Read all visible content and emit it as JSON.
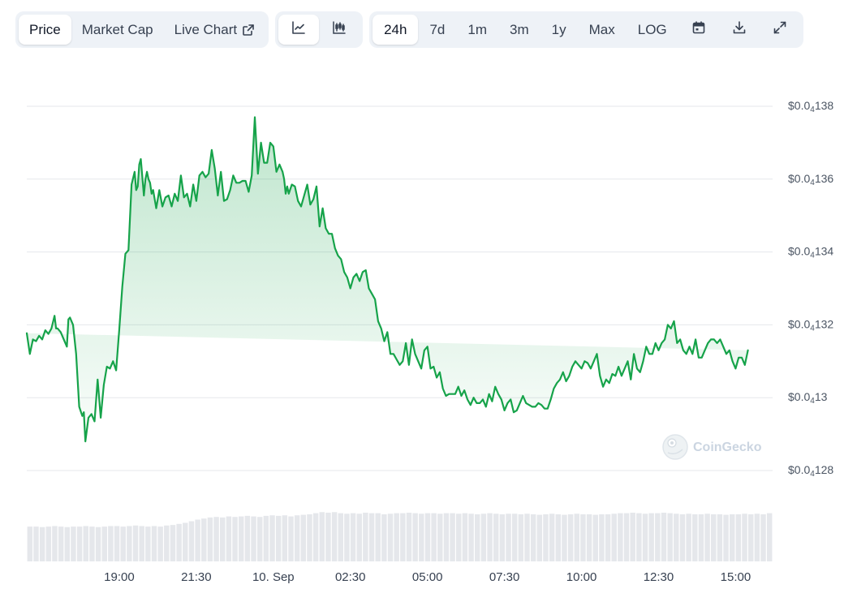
{
  "toolbar": {
    "view_tabs": [
      {
        "label": "Price",
        "active": true
      },
      {
        "label": "Market Cap",
        "active": false
      },
      {
        "label": "Live Chart",
        "active": false,
        "icon": "external-link-icon"
      }
    ],
    "chart_type_buttons": [
      {
        "icon": "line-chart-icon",
        "active": true
      },
      {
        "icon": "candlestick-chart-icon",
        "active": false
      }
    ],
    "time_ranges": [
      {
        "label": "24h",
        "active": true
      },
      {
        "label": "7d",
        "active": false
      },
      {
        "label": "1m",
        "active": false
      },
      {
        "label": "3m",
        "active": false
      },
      {
        "label": "1y",
        "active": false
      },
      {
        "label": "Max",
        "active": false
      },
      {
        "label": "LOG",
        "active": false
      }
    ],
    "tool_icons": [
      "calendar-icon",
      "download-icon",
      "expand-icon"
    ]
  },
  "watermark": {
    "text": "CoinGecko",
    "icon": "coingecko-logo-icon"
  },
  "colors": {
    "line": "#16a34a",
    "area_top": "#16a34a",
    "grid": "#e5e7eb",
    "volume": "#e5e7eb",
    "toolbar_bg": "#eef2f7"
  },
  "chart_data": {
    "type": "area",
    "title": "",
    "xlabel": "",
    "ylabel": "",
    "ylim": [
      1.28e-05,
      1.38e-05
    ],
    "y_ticks": [
      {
        "value": 1.38e-05,
        "prefix": "$0.0",
        "sub": "4",
        "digits": "138"
      },
      {
        "value": 1.36e-05,
        "prefix": "$0.0",
        "sub": "4",
        "digits": "136"
      },
      {
        "value": 1.34e-05,
        "prefix": "$0.0",
        "sub": "4",
        "digits": "134"
      },
      {
        "value": 1.32e-05,
        "prefix": "$0.0",
        "sub": "4",
        "digits": "132"
      },
      {
        "value": 1.3e-05,
        "prefix": "$0.0",
        "sub": "4",
        "digits": "13"
      },
      {
        "value": 1.28e-05,
        "prefix": "$0.0",
        "sub": "4",
        "digits": "128"
      }
    ],
    "x_ticks": [
      {
        "label": "19:00",
        "hours": 3.0
      },
      {
        "label": "21:30",
        "hours": 5.5
      },
      {
        "label": "10. Sep",
        "hours": 8.0
      },
      {
        "label": "02:30",
        "hours": 10.5
      },
      {
        "label": "05:00",
        "hours": 13.0
      },
      {
        "label": "07:30",
        "hours": 15.5
      },
      {
        "label": "10:00",
        "hours": 18.0
      },
      {
        "label": "12:30",
        "hours": 20.5
      },
      {
        "label": "15:00",
        "hours": 23.0
      }
    ],
    "x_range_hours": [
      0,
      24.2
    ],
    "grid": true,
    "price_series": {
      "hours": [
        0.0,
        0.1,
        0.2,
        0.3,
        0.4,
        0.5,
        0.6,
        0.7,
        0.8,
        0.9,
        0.95,
        1.0,
        1.1,
        1.2,
        1.3,
        1.35,
        1.4,
        1.5,
        1.6,
        1.7,
        1.8,
        1.85,
        1.9,
        2.0,
        2.1,
        2.2,
        2.3,
        2.4,
        2.5,
        2.6,
        2.7,
        2.8,
        2.9,
        3.0,
        3.1,
        3.2,
        3.3,
        3.4,
        3.5,
        3.55,
        3.6,
        3.65,
        3.7,
        3.8,
        3.85,
        3.9,
        3.95,
        4.0,
        4.05,
        4.1,
        4.15,
        4.2,
        4.3,
        4.4,
        4.5,
        4.6,
        4.7,
        4.8,
        4.9,
        5.0,
        5.1,
        5.2,
        5.3,
        5.4,
        5.5,
        5.6,
        5.7,
        5.8,
        5.9,
        6.0,
        6.1,
        6.2,
        6.3,
        6.4,
        6.5,
        6.6,
        6.7,
        6.8,
        6.9,
        7.0,
        7.1,
        7.2,
        7.3,
        7.4,
        7.5,
        7.6,
        7.7,
        7.8,
        7.9,
        8.0,
        8.1,
        8.2,
        8.3,
        8.35,
        8.4,
        8.45,
        8.5,
        8.6,
        8.7,
        8.8,
        8.9,
        9.0,
        9.1,
        9.2,
        9.3,
        9.4,
        9.5,
        9.6,
        9.7,
        9.8,
        9.9,
        10.0,
        10.1,
        10.2,
        10.3,
        10.4,
        10.5,
        10.6,
        10.7,
        10.8,
        10.9,
        11.0,
        11.1,
        11.2,
        11.3,
        11.4,
        11.5,
        11.6,
        11.7,
        11.8,
        11.9,
        12.0,
        12.1,
        12.2,
        12.3,
        12.4,
        12.5,
        12.6,
        12.7,
        12.8,
        12.9,
        13.0,
        13.1,
        13.2,
        13.3,
        13.4,
        13.5,
        13.6,
        13.7,
        13.8,
        13.9,
        14.0,
        14.1,
        14.2,
        14.3,
        14.4,
        14.5,
        14.6,
        14.7,
        14.8,
        14.9,
        15.0,
        15.1,
        15.2,
        15.3,
        15.4,
        15.5,
        15.6,
        15.7,
        15.8,
        15.9,
        16.0,
        16.1,
        16.2,
        16.3,
        16.4,
        16.5,
        16.6,
        16.7,
        16.8,
        16.9,
        17.0,
        17.1,
        17.2,
        17.3,
        17.4,
        17.5,
        17.6,
        17.7,
        17.8,
        17.9,
        18.0,
        18.1,
        18.2,
        18.3,
        18.4,
        18.5,
        18.6,
        18.7,
        18.8,
        18.9,
        19.0,
        19.1,
        19.2,
        19.3,
        19.4,
        19.5,
        19.6,
        19.7,
        19.8,
        19.9,
        20.0,
        20.1,
        20.2,
        20.3,
        20.4,
        20.5,
        20.6,
        20.7,
        20.8,
        20.9,
        21.0,
        21.1,
        21.2,
        21.3,
        21.4,
        21.5,
        21.6,
        21.7,
        21.8,
        21.9,
        22.0,
        22.1,
        22.2,
        22.3,
        22.4,
        22.5,
        22.6,
        22.7,
        22.8,
        22.9,
        23.0,
        23.1,
        23.2,
        23.3,
        23.4,
        23.5,
        23.6,
        23.7,
        23.8,
        23.9,
        24.0
      ],
      "values": [
        13.177,
        13.12,
        13.16,
        13.155,
        13.17,
        13.16,
        13.185,
        13.175,
        13.19,
        13.225,
        13.19,
        13.19,
        13.18,
        13.16,
        13.14,
        13.215,
        13.22,
        13.2,
        13.12,
        12.975,
        12.95,
        12.96,
        12.88,
        12.945,
        12.955,
        12.935,
        13.05,
        12.945,
        13.035,
        13.085,
        13.08,
        13.1,
        13.075,
        13.185,
        13.305,
        13.395,
        13.405,
        13.585,
        13.62,
        13.57,
        13.58,
        13.64,
        13.655,
        13.555,
        13.6,
        13.62,
        13.6,
        13.59,
        13.56,
        13.57,
        13.545,
        13.52,
        13.57,
        13.525,
        13.55,
        13.555,
        13.525,
        13.56,
        13.54,
        13.61,
        13.55,
        13.56,
        13.525,
        13.585,
        13.54,
        13.61,
        13.62,
        13.605,
        13.615,
        13.68,
        13.63,
        13.555,
        13.62,
        13.54,
        13.545,
        13.57,
        13.61,
        13.59,
        13.59,
        13.595,
        13.595,
        13.565,
        13.61,
        13.77,
        13.615,
        13.7,
        13.645,
        13.645,
        13.7,
        13.69,
        13.62,
        13.64,
        13.62,
        13.6,
        13.56,
        13.58,
        13.56,
        13.585,
        13.58,
        13.54,
        13.525,
        13.555,
        13.585,
        13.53,
        13.545,
        13.58,
        13.47,
        13.52,
        13.465,
        13.45,
        13.45,
        13.41,
        13.39,
        13.38,
        13.345,
        13.33,
        13.3,
        13.33,
        13.34,
        13.32,
        13.345,
        13.35,
        13.3,
        13.285,
        13.27,
        13.21,
        13.19,
        13.155,
        13.18,
        13.12,
        13.12,
        13.105,
        13.09,
        13.1,
        13.15,
        13.09,
        13.16,
        13.12,
        13.1,
        13.08,
        13.13,
        13.14,
        13.08,
        13.085,
        13.055,
        13.07,
        13.025,
        13.005,
        13.01,
        13.01,
        13.01,
        13.03,
        13.005,
        13.02,
        12.995,
        12.98,
        13.0,
        12.985,
        12.985,
        12.995,
        12.975,
        13.01,
        12.99,
        13.03,
        13.01,
        12.995,
        12.965,
        12.985,
        12.995,
        12.96,
        12.965,
        12.985,
        13.005,
        12.985,
        12.98,
        12.975,
        12.975,
        12.985,
        12.98,
        12.97,
        12.97,
        12.995,
        13.025,
        13.04,
        13.05,
        13.07,
        13.045,
        13.06,
        13.085,
        13.1,
        13.09,
        13.08,
        13.1,
        13.095,
        13.08,
        13.1,
        13.12,
        13.06,
        13.03,
        13.05,
        13.04,
        13.065,
        13.06,
        13.085,
        13.06,
        13.08,
        13.1,
        13.05,
        13.12,
        13.08,
        13.07,
        13.1,
        13.14,
        13.12,
        13.12,
        13.15,
        13.13,
        13.15,
        13.16,
        13.2,
        13.19,
        13.21,
        13.15,
        13.16,
        13.13,
        13.12,
        13.14,
        13.12,
        13.16,
        13.11,
        13.11,
        13.13,
        13.15,
        13.16,
        13.16,
        13.15,
        13.16,
        13.14,
        13.12,
        13.13,
        13.1,
        13.08,
        13.11,
        13.11,
        13.09,
        13.13
      ],
      "scale_note": "values are in units of $0.000001 (i.e. 13.177 = $0.0000131770)"
    },
    "volume_series": {
      "count": 120,
      "relative_heights": [
        0.65,
        0.65,
        0.64,
        0.65,
        0.66,
        0.65,
        0.64,
        0.65,
        0.65,
        0.66,
        0.65,
        0.64,
        0.65,
        0.66,
        0.66,
        0.65,
        0.66,
        0.67,
        0.66,
        0.65,
        0.66,
        0.65,
        0.67,
        0.68,
        0.7,
        0.72,
        0.75,
        0.78,
        0.8,
        0.82,
        0.83,
        0.82,
        0.84,
        0.83,
        0.84,
        0.85,
        0.84,
        0.83,
        0.85,
        0.86,
        0.85,
        0.86,
        0.84,
        0.86,
        0.87,
        0.88,
        0.9,
        0.92,
        0.91,
        0.92,
        0.9,
        0.89,
        0.9,
        0.89,
        0.91,
        0.9,
        0.9,
        0.88,
        0.89,
        0.9,
        0.9,
        0.91,
        0.9,
        0.89,
        0.9,
        0.9,
        0.89,
        0.9,
        0.9,
        0.89,
        0.9,
        0.89,
        0.88,
        0.89,
        0.9,
        0.89,
        0.88,
        0.89,
        0.89,
        0.88,
        0.89,
        0.88,
        0.87,
        0.88,
        0.89,
        0.88,
        0.87,
        0.88,
        0.89,
        0.88,
        0.88,
        0.87,
        0.88,
        0.88,
        0.89,
        0.9,
        0.9,
        0.91,
        0.9,
        0.89,
        0.9,
        0.9,
        0.91,
        0.9,
        0.89,
        0.88,
        0.89,
        0.88,
        0.88,
        0.89,
        0.88,
        0.88,
        0.87,
        0.88,
        0.88,
        0.89,
        0.88,
        0.89,
        0.88,
        0.9
      ]
    }
  }
}
